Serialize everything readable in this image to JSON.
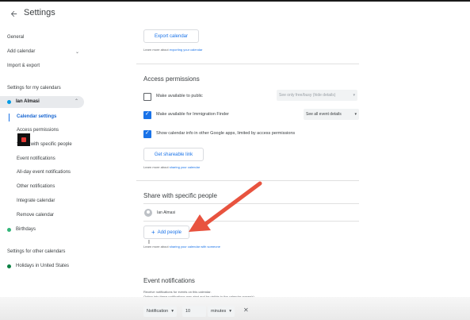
{
  "header": {
    "title": "Settings",
    "back_icon": "arrow-back-icon"
  },
  "sidebar": {
    "general": "General",
    "add_calendar": "Add calendar",
    "import_export": "Import & export",
    "my_calendars_heading": "Settings for my calendars",
    "selected_calendar": "Ian Almasi",
    "sub_items": [
      "Calendar settings",
      "Access permissions",
      "Share with specific people",
      "Event notifications",
      "All-day event notifications",
      "Other notifications",
      "Integrate calendar",
      "Remove calendar"
    ],
    "birthdays": "Birthdays",
    "other_calendars_heading": "Settings for other calendars",
    "holidays": "Holidays in United States",
    "colors": {
      "ian": "#039be5",
      "birthdays": "#33b679",
      "holidays": "#0b8043"
    }
  },
  "export": {
    "button": "Export calendar",
    "learn_prefix": "Learn more about ",
    "learn_link": "exporting your calendar"
  },
  "access": {
    "title": "Access permissions",
    "public_label": "Make available to public",
    "public_checked": false,
    "public_select": "See only free/busy (hide details)",
    "immigration_label": "Make available for Immigration Finder",
    "immigration_checked": true,
    "immigration_select": "See all event details",
    "show_info_label": "Show calendar info in other Google apps, limited by access permissions",
    "show_info_checked": true,
    "shareable_button": "Get shareable link",
    "learn_prefix": "Learn more about ",
    "learn_link": "sharing your calendar"
  },
  "share": {
    "title": "Share with specific people",
    "person": "Ian Almasi",
    "add_button": "Add people",
    "learn_prefix": "Learn more about ",
    "learn_link": "sharing your calendar with someone"
  },
  "notifications": {
    "title": "Event notifications",
    "desc1": "Receive notifications for events on this calendar.",
    "desc2": "Opting into these notifications may alert and be visible to the calendar owner(s)",
    "type": "Notification",
    "amount": "10",
    "unit": "minutes"
  },
  "accent": "#1a73e8",
  "annotation_color": "#e8533f"
}
